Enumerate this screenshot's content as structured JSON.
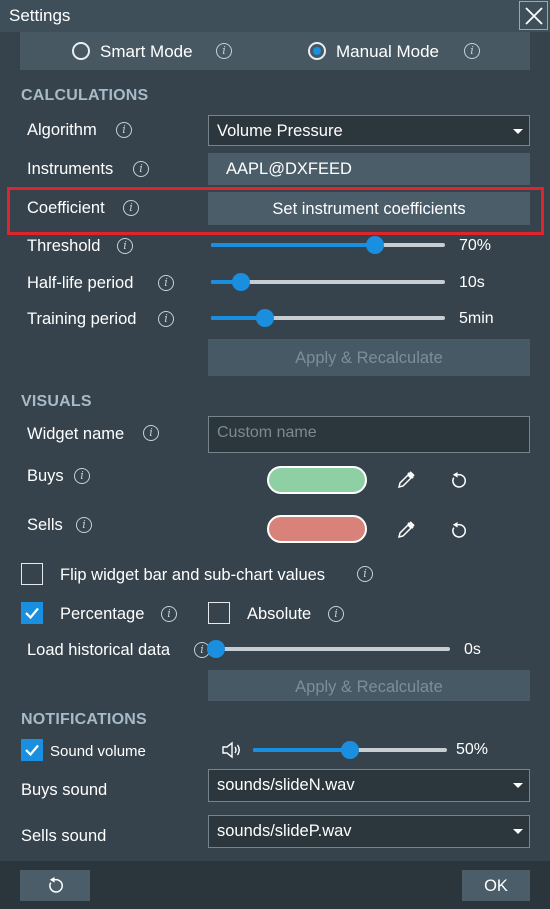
{
  "window": {
    "title": "Settings"
  },
  "mode": {
    "smart_label": "Smart Mode",
    "manual_label": "Manual Mode",
    "selected": "Manual Mode"
  },
  "calculations": {
    "header": "CALCULATIONS",
    "algorithm_label": "Algorithm",
    "algorithm_value": "Volume Pressure",
    "instruments_label": "Instruments",
    "instruments_value": "AAPL@DXFEED",
    "coefficient_label": "Coefficient",
    "coefficient_button": "Set instrument coefficients",
    "threshold_label": "Threshold",
    "threshold_value": "70%",
    "threshold_fraction": 0.7,
    "halflife_label": "Half-life period",
    "halflife_value": "10s",
    "halflife_fraction": 0.13,
    "training_label": "Training period",
    "training_value": "5min",
    "training_fraction": 0.23,
    "apply_label": "Apply & Recalculate"
  },
  "visuals": {
    "header": "VISUALS",
    "widget_name_label": "Widget name",
    "widget_name_placeholder": "Custom name",
    "widget_name_value": "",
    "buys_label": "Buys",
    "buys_color": "#8fcfa4",
    "sells_label": "Sells",
    "sells_color": "#d9827a",
    "flip_label": "Flip widget bar and sub-chart values",
    "flip_checked": false,
    "percentage_label": "Percentage",
    "percentage_checked": true,
    "absolute_label": "Absolute",
    "absolute_checked": false,
    "load_label": "Load historical data",
    "load_value": "0s",
    "load_fraction": 0.0,
    "apply_label": "Apply & Recalculate"
  },
  "notifications": {
    "header": "NOTIFICATIONS",
    "sound_volume_label": "Sound volume",
    "sound_volume_checked": true,
    "volume_value": "50%",
    "volume_fraction": 0.5,
    "buys_sound_label": "Buys sound",
    "buys_sound_value": "sounds/slideN.wav",
    "sells_sound_label": "Sells sound",
    "sells_sound_value": "sounds/slideP.wav"
  },
  "footer": {
    "ok_label": "OK"
  },
  "colors": {
    "accent": "#1a8fe0",
    "highlight": "#e0242b"
  },
  "icons": [
    "close-icon",
    "info-icon",
    "eyedropper-icon",
    "reset-icon",
    "speaker-icon",
    "checkmark-icon",
    "chevron-down-icon"
  ]
}
